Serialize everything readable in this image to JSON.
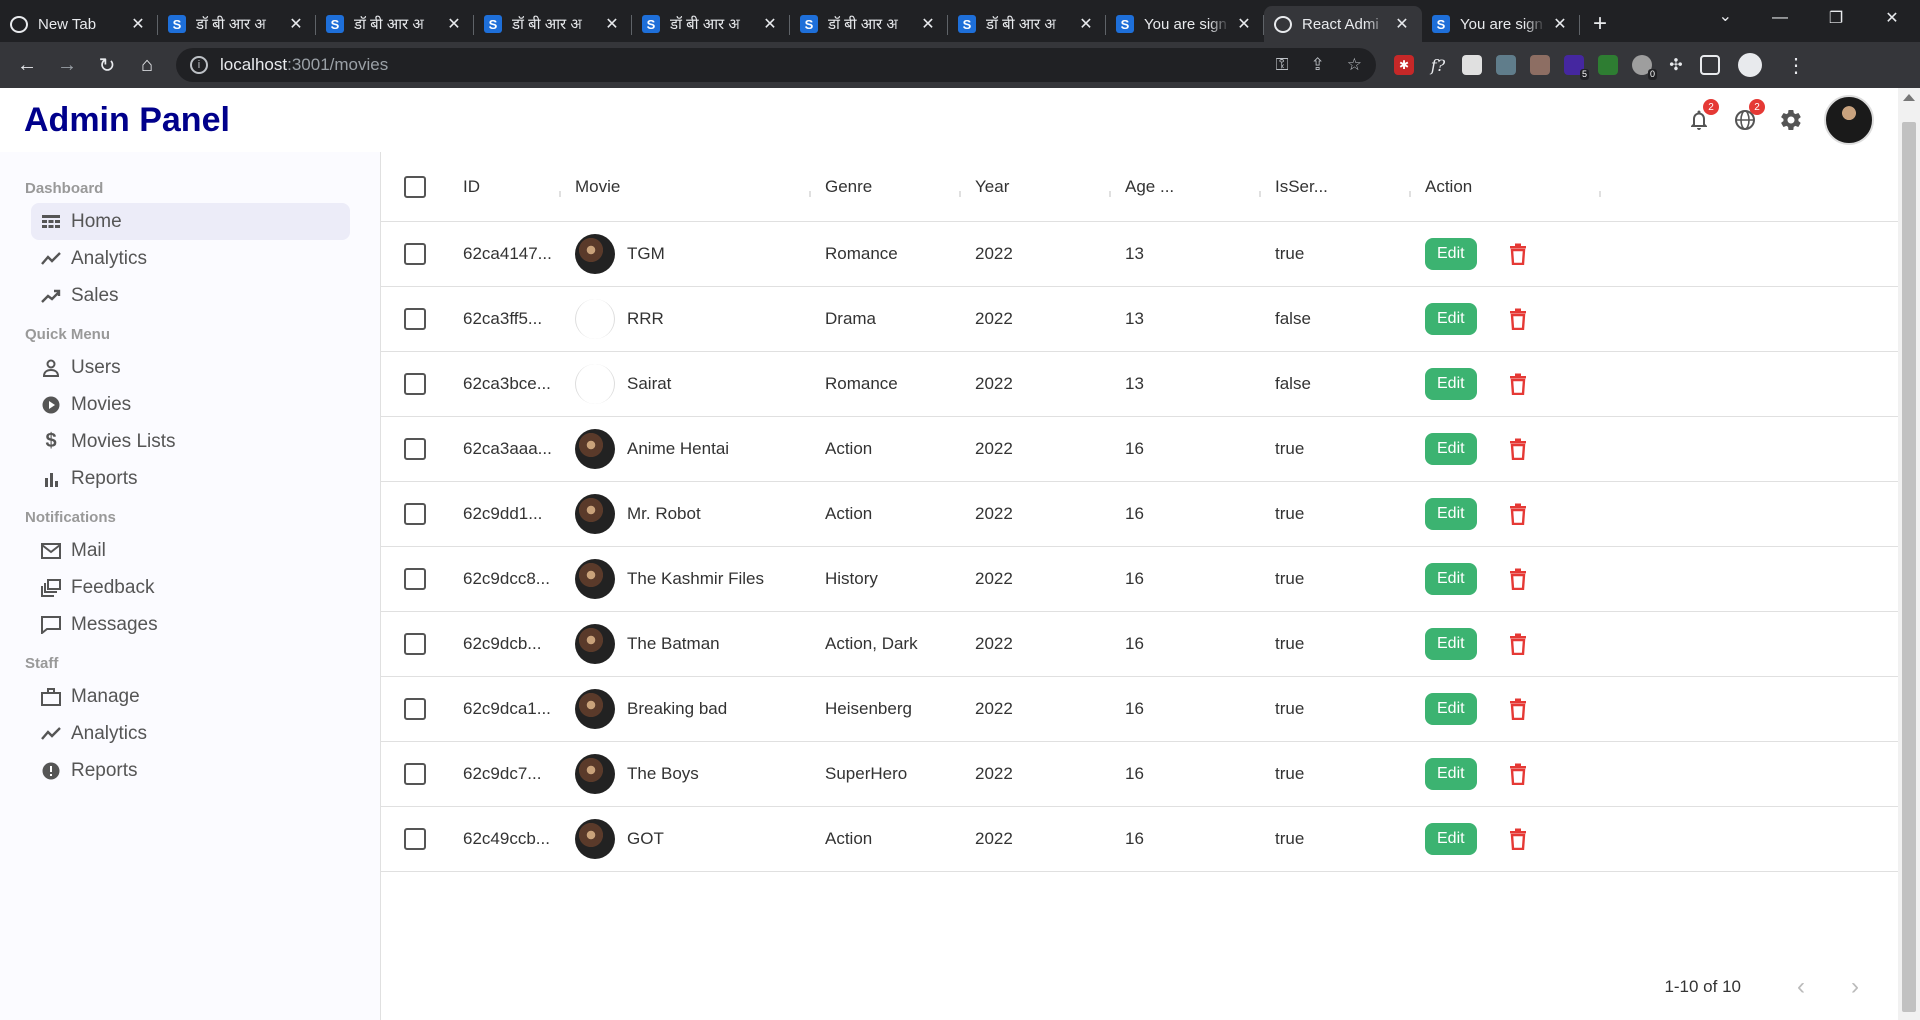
{
  "browser": {
    "tabs": [
      {
        "title": "New Tab",
        "favicon": "chrome-icon",
        "active": false
      },
      {
        "title": "डॉ बी आर अ",
        "favicon": "S",
        "active": false
      },
      {
        "title": "डॉ बी आर अ",
        "favicon": "S",
        "active": false
      },
      {
        "title": "डॉ बी आर अ",
        "favicon": "S",
        "active": false
      },
      {
        "title": "डॉ बी आर अ",
        "favicon": "S",
        "active": false
      },
      {
        "title": "डॉ बी आर अ",
        "favicon": "S",
        "active": false
      },
      {
        "title": "डॉ बी आर अ",
        "favicon": "S",
        "active": false
      },
      {
        "title": "You are sign",
        "favicon": "S",
        "active": false
      },
      {
        "title": "React Admi",
        "favicon": "globe-icon",
        "active": true
      },
      {
        "title": "You are sign",
        "favicon": "S",
        "active": false
      }
    ],
    "url_host": "localhost",
    "url_path": ":3001/movies",
    "extension_badges": {
      "ext6": "5",
      "ext8": "0"
    }
  },
  "app": {
    "brand": "Admin Panel",
    "notifications_count": "2",
    "language_count": "2"
  },
  "sidebar": {
    "sections": [
      {
        "title": "Dashboard",
        "items": [
          {
            "label": "Home",
            "icon": "table-icon",
            "active": true
          },
          {
            "label": "Analytics",
            "icon": "trending-icon",
            "active": false
          },
          {
            "label": "Sales",
            "icon": "trending-up-icon",
            "active": false
          }
        ]
      },
      {
        "title": "Quick Menu",
        "items": [
          {
            "label": "Users",
            "icon": "user-icon",
            "active": false
          },
          {
            "label": "Movies",
            "icon": "play-circle-icon",
            "active": false
          },
          {
            "label": "Movies Lists",
            "icon": "dollar-icon",
            "active": false
          },
          {
            "label": "Reports",
            "icon": "bar-chart-icon",
            "active": false
          }
        ]
      },
      {
        "title": "Notifications",
        "items": [
          {
            "label": "Mail",
            "icon": "mail-icon",
            "active": false
          },
          {
            "label": "Feedback",
            "icon": "dynamic-feed-icon",
            "active": false
          },
          {
            "label": "Messages",
            "icon": "chat-bubble-icon",
            "active": false
          }
        ]
      },
      {
        "title": "Staff",
        "items": [
          {
            "label": "Manage",
            "icon": "briefcase-icon",
            "active": false
          },
          {
            "label": "Analytics",
            "icon": "timeline-icon",
            "active": false
          },
          {
            "label": "Reports",
            "icon": "report-icon",
            "active": false
          }
        ]
      }
    ]
  },
  "grid": {
    "columns": [
      "ID",
      "Movie",
      "Genre",
      "Year",
      "Age ...",
      "IsSer...",
      "Action"
    ],
    "edit_label": "Edit",
    "rows": [
      {
        "id": "62ca4147...",
        "movie": "TGM",
        "genre": "Romance",
        "year": "2022",
        "age": "13",
        "series": "true",
        "thumb": true
      },
      {
        "id": "62ca3ff5...",
        "movie": "RRR",
        "genre": "Drama",
        "year": "2022",
        "age": "13",
        "series": "false",
        "thumb": false
      },
      {
        "id": "62ca3bce...",
        "movie": "Sairat",
        "genre": "Romance",
        "year": "2022",
        "age": "13",
        "series": "false",
        "thumb": false
      },
      {
        "id": "62ca3aaa...",
        "movie": "Anime Hentai",
        "genre": "Action",
        "year": "2022",
        "age": "16",
        "series": "true",
        "thumb": true
      },
      {
        "id": "62c9dd1...",
        "movie": "Mr. Robot",
        "genre": "Action",
        "year": "2022",
        "age": "16",
        "series": "true",
        "thumb": true
      },
      {
        "id": "62c9dcc8...",
        "movie": "The Kashmir Files",
        "genre": "History",
        "year": "2022",
        "age": "16",
        "series": "true",
        "thumb": true
      },
      {
        "id": "62c9dcb...",
        "movie": "The Batman",
        "genre": "Action, Dark",
        "year": "2022",
        "age": "16",
        "series": "true",
        "thumb": true
      },
      {
        "id": "62c9dca1...",
        "movie": "Breaking bad",
        "genre": "Heisenberg",
        "year": "2022",
        "age": "16",
        "series": "true",
        "thumb": true
      },
      {
        "id": "62c9dc7...",
        "movie": "The Boys",
        "genre": "SuperHero",
        "year": "2022",
        "age": "16",
        "series": "true",
        "thumb": true
      },
      {
        "id": "62c49ccb...",
        "movie": "GOT",
        "genre": "Action",
        "year": "2022",
        "age": "16",
        "series": "true",
        "thumb": true
      }
    ],
    "pagination": "1-10 of 10"
  },
  "colors": {
    "brand": "#00008b",
    "edit_button": "#3cb371",
    "delete_icon": "#e53935",
    "active_item_bg": "#ececf8"
  }
}
